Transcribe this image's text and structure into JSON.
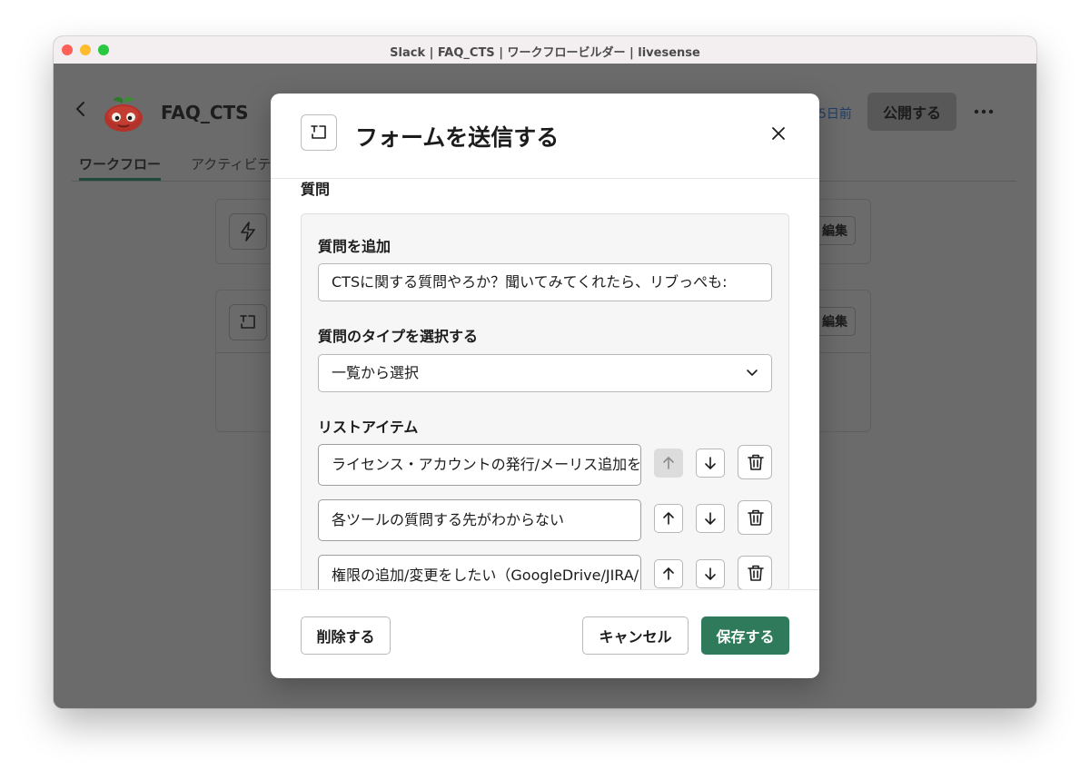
{
  "window": {
    "title": "Slack | FAQ_CTS | ワークフロービルダー | livesense"
  },
  "workflow": {
    "name": "FAQ_CTS",
    "updated": "5日前",
    "publish_label": "公開する",
    "tabs": [
      {
        "label": "ワークフロー"
      },
      {
        "label": "アクティビテ"
      }
    ],
    "steps": [
      {
        "edit_label": "編集",
        "icon": "lightning-icon"
      },
      {
        "edit_label": "編集",
        "icon": "form-icon"
      }
    ]
  },
  "modal": {
    "title": "フォームを送信する",
    "icon": "form-icon",
    "section_label": "質問",
    "question": {
      "add_label": "質問を追加",
      "value": "CTSに関する質問やろか？聞いてみてくれたら、リブっぺも:",
      "type_label": "質問のタイプを選択する",
      "type_value": "一覧から選択",
      "list_label": "リストアイテム",
      "items": [
        {
          "value": "ライセンス・アカウントの発行/メーリス追加を"
        },
        {
          "value": "各ツールの質問する先がわからない"
        },
        {
          "value": "権限の追加/変更をしたい（GoogleDrive/JIRA/"
        }
      ]
    },
    "footer": {
      "delete_label": "削除する",
      "cancel_label": "キャンセル",
      "save_label": "保存する"
    }
  },
  "colors": {
    "primary": "#2e7a5b",
    "overlay": "#6b6b6b",
    "link": "#1f3d66"
  }
}
